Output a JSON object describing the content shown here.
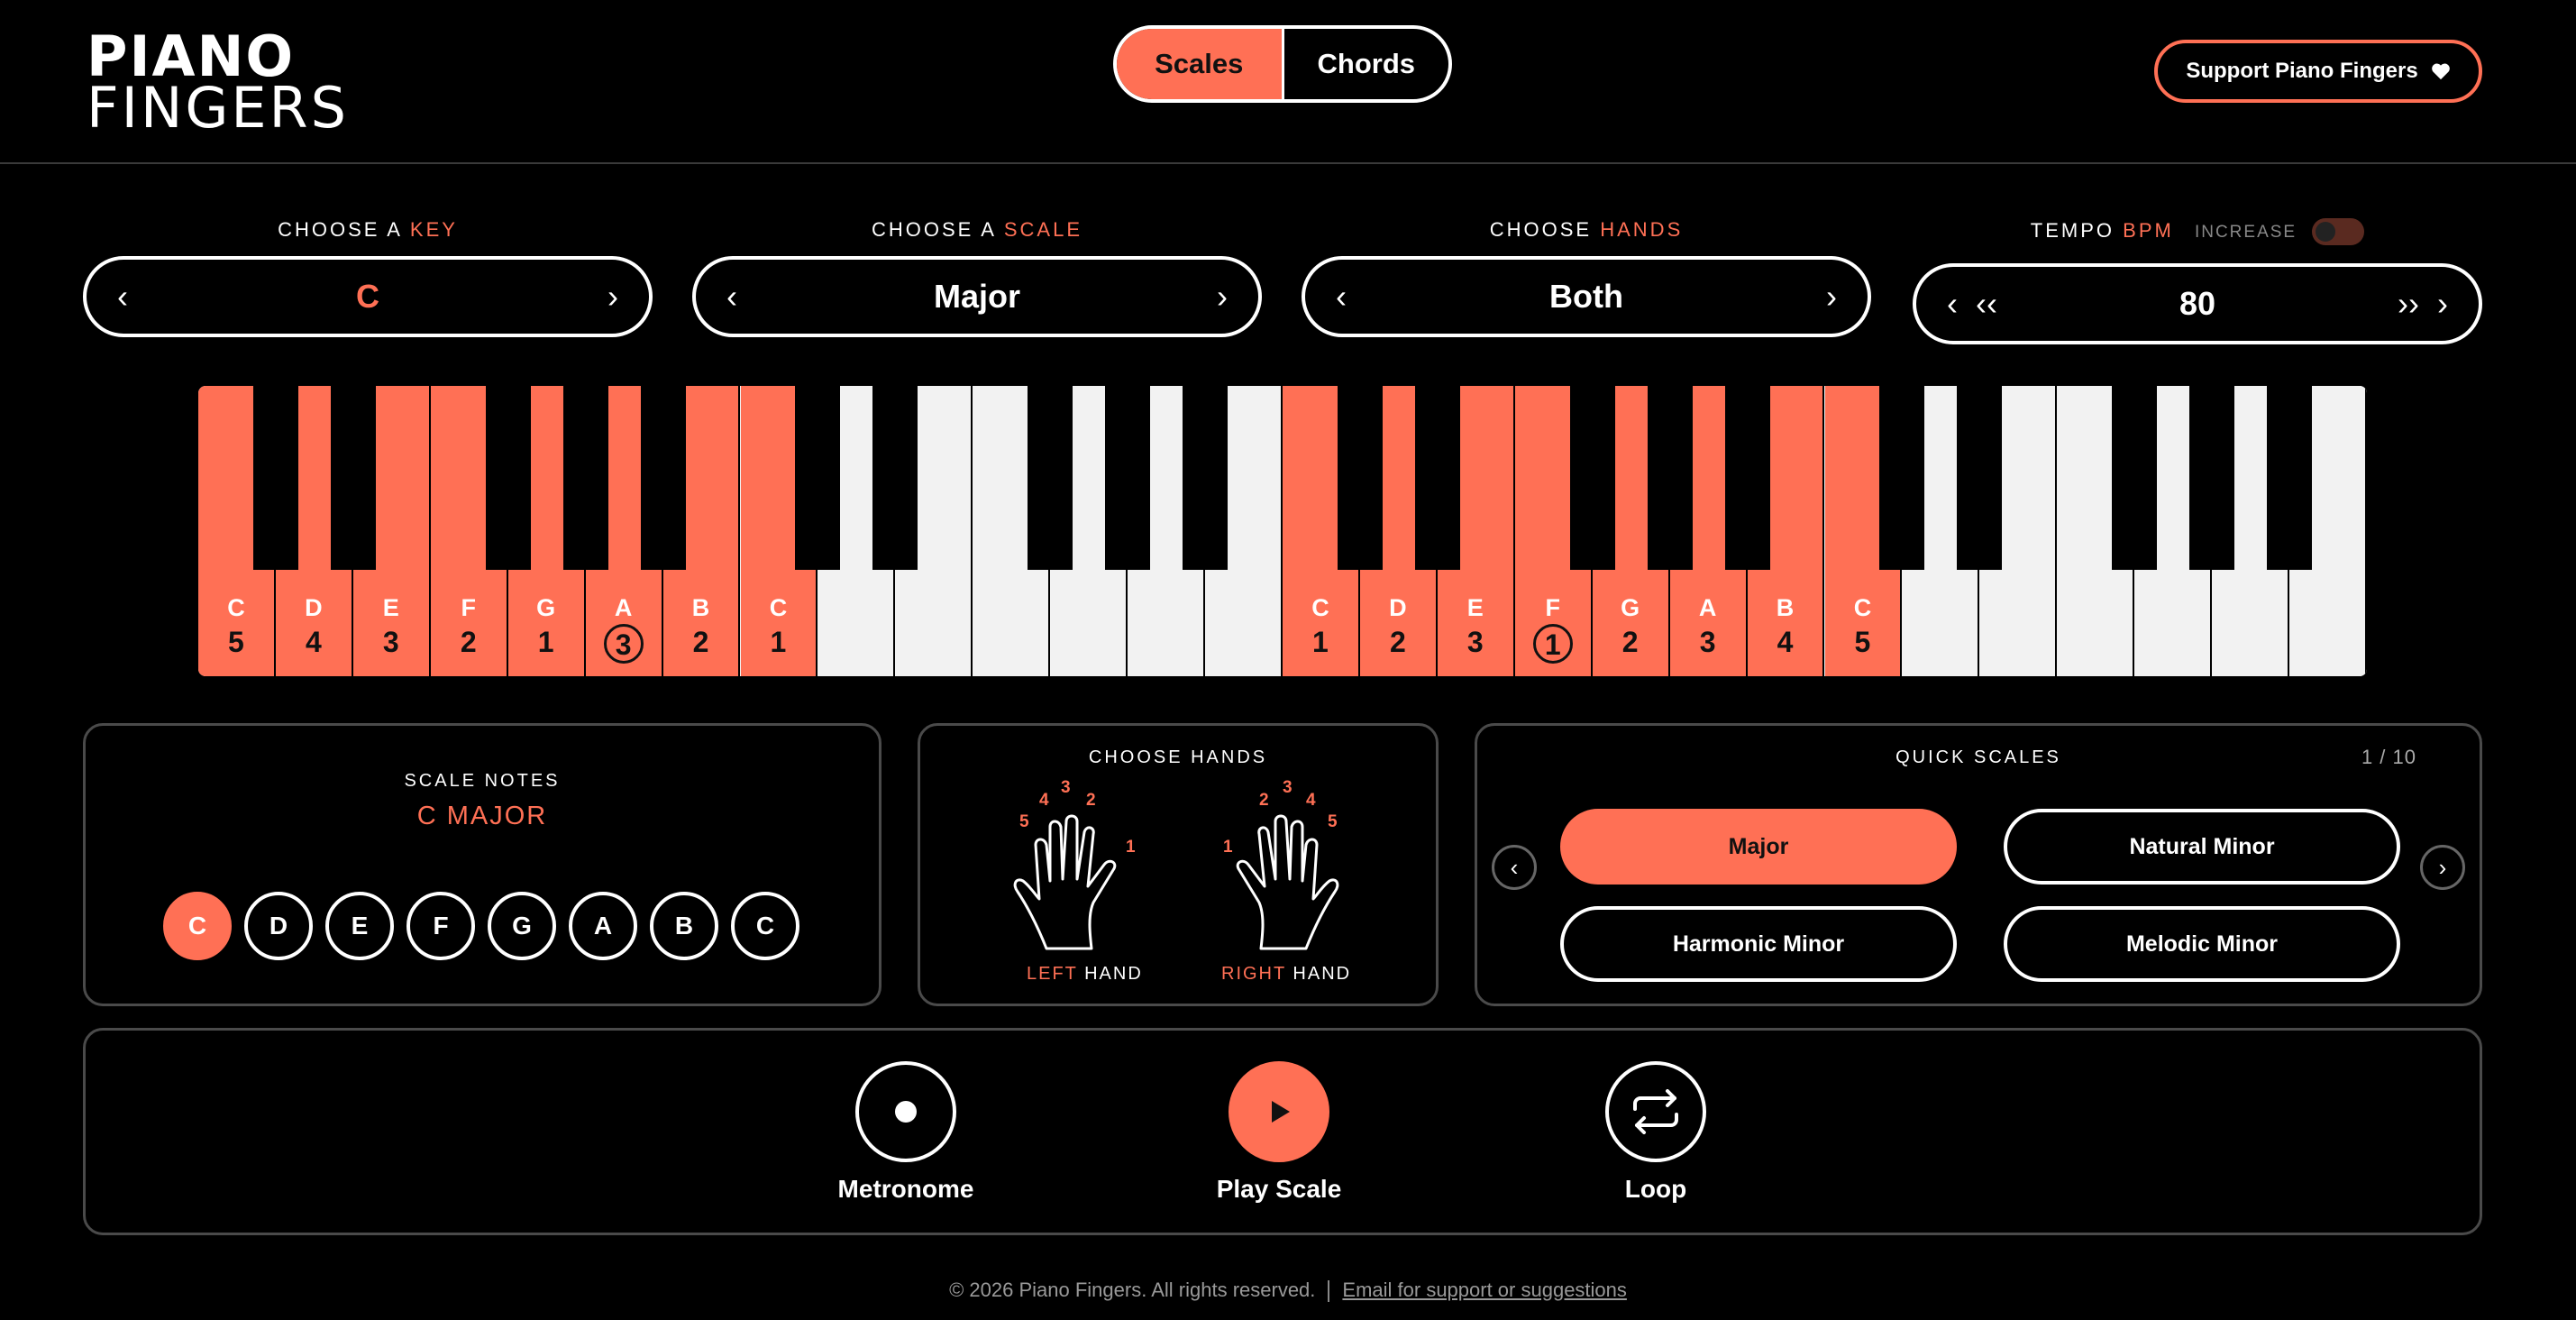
{
  "brand": {
    "line1": "PIANO",
    "line2": "FINGERS"
  },
  "mode": {
    "scales_label": "Scales",
    "chords_label": "Chords",
    "active": "Scales"
  },
  "support": {
    "label": "Support Piano Fingers",
    "icon": "heart-icon"
  },
  "key_select": {
    "prefix": "CHOOSE A",
    "highlight": "KEY",
    "value": "C",
    "prev": "‹",
    "next": "›"
  },
  "scale_select": {
    "prefix": "CHOOSE A",
    "highlight": "SCALE",
    "value": "Major",
    "prev": "‹",
    "next": "›"
  },
  "hands_select": {
    "prefix": "CHOOSE",
    "highlight": "HANDS",
    "value": "Both",
    "prev": "‹",
    "next": "›"
  },
  "tempo": {
    "prefix": "TEMPO",
    "highlight": "BPM",
    "increase_label": "INCREASE",
    "increase_on": false,
    "value": "80",
    "prev": "‹",
    "prev_fast": "‹‹",
    "next_fast": "››",
    "next": "›"
  },
  "piano": {
    "white_keys": [
      {
        "note": "C",
        "finger": "5",
        "on": true,
        "circled": false
      },
      {
        "note": "D",
        "finger": "4",
        "on": true,
        "circled": false
      },
      {
        "note": "E",
        "finger": "3",
        "on": true,
        "circled": false
      },
      {
        "note": "F",
        "finger": "2",
        "on": true,
        "circled": false
      },
      {
        "note": "G",
        "finger": "1",
        "on": true,
        "circled": false
      },
      {
        "note": "A",
        "finger": "3",
        "on": true,
        "circled": true
      },
      {
        "note": "B",
        "finger": "2",
        "on": true,
        "circled": false
      },
      {
        "note": "C",
        "finger": "1",
        "on": true,
        "circled": false
      },
      {
        "note": "",
        "finger": "",
        "on": false,
        "circled": false
      },
      {
        "note": "",
        "finger": "",
        "on": false,
        "circled": false
      },
      {
        "note": "",
        "finger": "",
        "on": false,
        "circled": false
      },
      {
        "note": "",
        "finger": "",
        "on": false,
        "circled": false
      },
      {
        "note": "",
        "finger": "",
        "on": false,
        "circled": false
      },
      {
        "note": "",
        "finger": "",
        "on": false,
        "circled": false
      },
      {
        "note": "C",
        "finger": "1",
        "on": true,
        "circled": false
      },
      {
        "note": "D",
        "finger": "2",
        "on": true,
        "circled": false
      },
      {
        "note": "E",
        "finger": "3",
        "on": true,
        "circled": false
      },
      {
        "note": "F",
        "finger": "1",
        "on": true,
        "circled": true
      },
      {
        "note": "G",
        "finger": "2",
        "on": true,
        "circled": false
      },
      {
        "note": "A",
        "finger": "3",
        "on": true,
        "circled": false
      },
      {
        "note": "B",
        "finger": "4",
        "on": true,
        "circled": false
      },
      {
        "note": "C",
        "finger": "5",
        "on": true,
        "circled": false
      },
      {
        "note": "",
        "finger": "",
        "on": false,
        "circled": false
      },
      {
        "note": "",
        "finger": "",
        "on": false,
        "circled": false
      },
      {
        "note": "",
        "finger": "",
        "on": false,
        "circled": false
      },
      {
        "note": "",
        "finger": "",
        "on": false,
        "circled": false
      },
      {
        "note": "",
        "finger": "",
        "on": false,
        "circled": false
      },
      {
        "note": "",
        "finger": "",
        "on": false,
        "circled": false
      }
    ]
  },
  "scale_notes": {
    "title": "SCALE NOTES",
    "scale_name": "C MAJOR",
    "notes": [
      "C",
      "D",
      "E",
      "F",
      "G",
      "A",
      "B",
      "C"
    ],
    "active_index": 0
  },
  "hands_panel": {
    "title": "CHOOSE HANDS",
    "left": {
      "highlight": "LEFT",
      "label": "HAND",
      "fingers": [
        "5",
        "4",
        "3",
        "2",
        "1"
      ]
    },
    "right": {
      "highlight": "RIGHT",
      "label": "HAND",
      "fingers": [
        "1",
        "2",
        "3",
        "4",
        "5"
      ]
    }
  },
  "quick_scales": {
    "title": "QUICK SCALES",
    "page": "1 / 10",
    "items": [
      "Major",
      "Natural Minor",
      "Harmonic Minor",
      "Melodic Minor"
    ],
    "active": "Major",
    "prev": "‹",
    "next": "›"
  },
  "controls": {
    "metronome": "Metronome",
    "play": "Play Scale",
    "loop": "Loop"
  },
  "footer": {
    "copyright": "© 2026 Piano Fingers. All rights reserved.",
    "link": "Email for support or suggestions"
  },
  "colors": {
    "accent": "#ff7055",
    "background": "#000000",
    "key_white": "#f2f2f2"
  }
}
